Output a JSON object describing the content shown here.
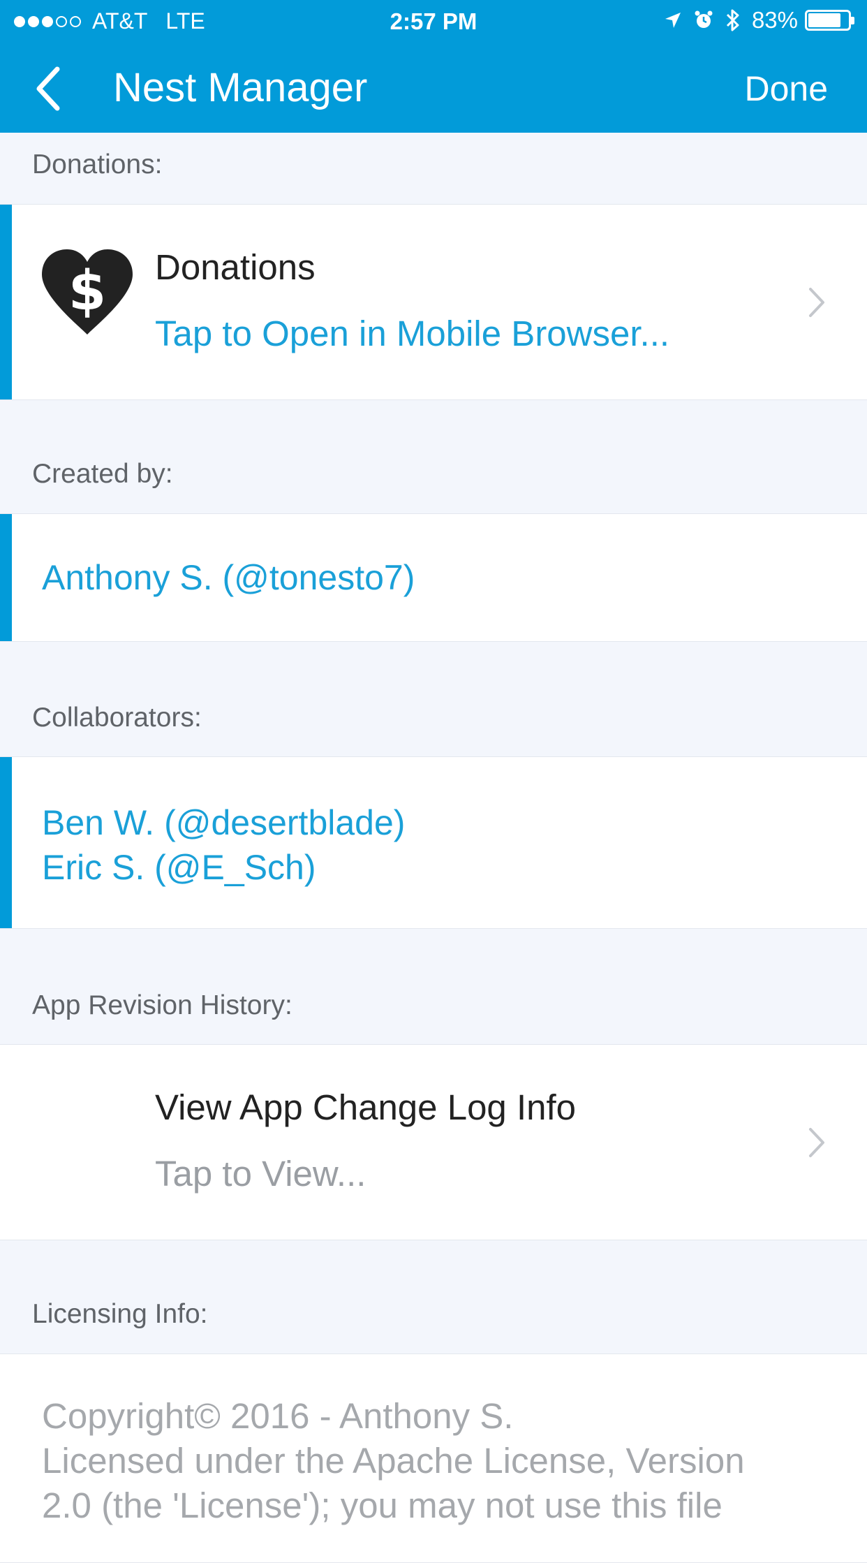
{
  "status_bar": {
    "carrier": "AT&T",
    "network": "LTE",
    "time": "2:57 PM",
    "battery": "83%",
    "battery_level": 0.83,
    "signal": {
      "filled": 3,
      "total": 5
    },
    "icons": [
      "location-arrow-icon",
      "alarm-icon",
      "bluetooth-icon",
      "battery-icon"
    ]
  },
  "nav": {
    "back_icon": "chevron-left-icon",
    "title": "Nest Manager",
    "done_label": "Done"
  },
  "sections": {
    "donations": {
      "label": "Donations:",
      "row": {
        "icon": "heart-dollar-icon",
        "title": "Donations",
        "subtitle": "Tap to Open in Mobile Browser..."
      }
    },
    "created_by": {
      "label": "Created by:",
      "name": "Anthony S. (@tonesto7)"
    },
    "collaborators": {
      "label": "Collaborators:",
      "names": [
        "Ben W. (@desertblade)",
        "Eric S. (@E_Sch)"
      ]
    },
    "revision_history": {
      "label": "App Revision History:",
      "row": {
        "title": "View App Change Log Info",
        "subtitle": "Tap to View..."
      }
    },
    "licensing": {
      "label": "Licensing Info:",
      "lines": [
        "Copyright© 2016 - Anthony S.",
        "Licensed under the Apache License, Version",
        "2.0 (the 'License'); you may not use this file"
      ]
    }
  },
  "colors": {
    "accent": "#029bd9",
    "link": "#1aa0d8",
    "background": "#f3f6fc"
  }
}
